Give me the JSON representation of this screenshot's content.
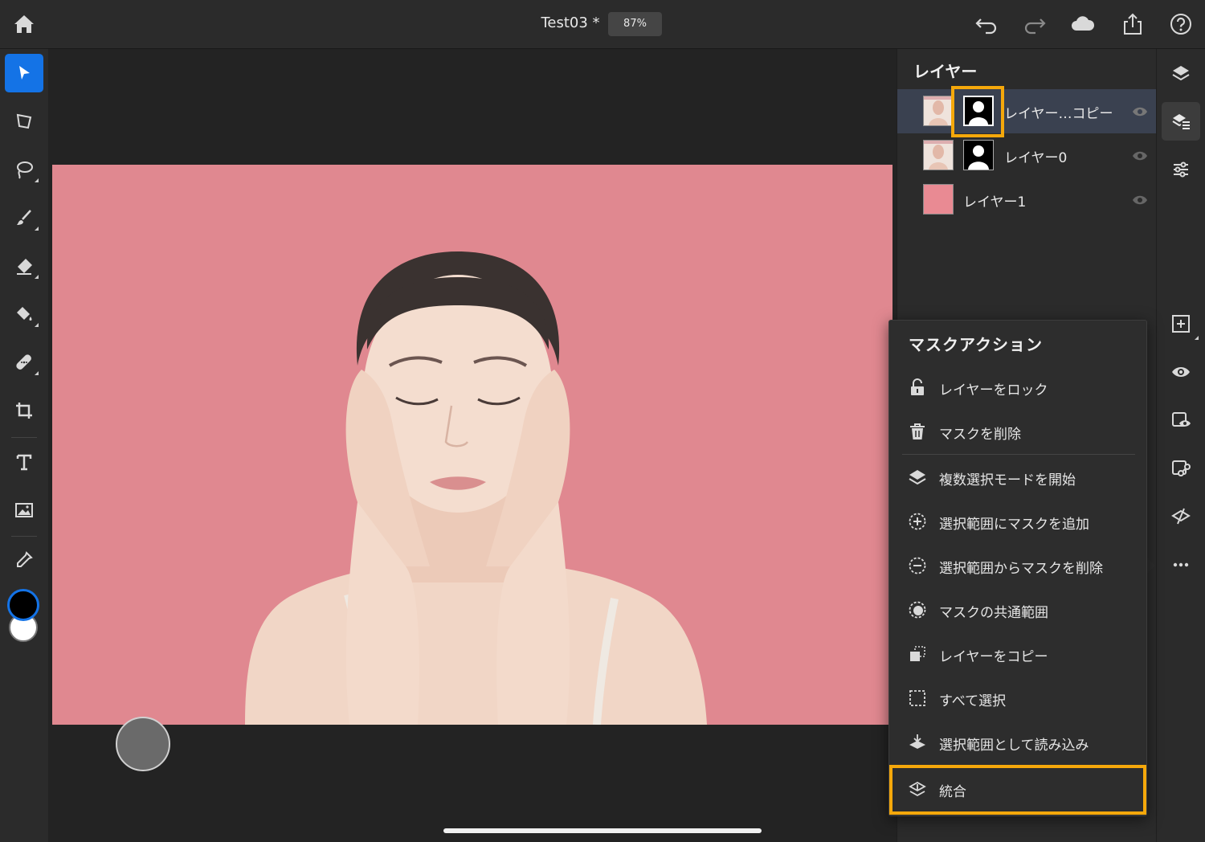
{
  "app": {
    "doc_title": "Test03 *",
    "zoom": "87%"
  },
  "layers_panel": {
    "title": "レイヤー",
    "layers": [
      {
        "name": "レイヤー…コピー",
        "selected": true,
        "has_mask": true
      },
      {
        "name": "レイヤー0",
        "selected": false,
        "has_mask": true
      },
      {
        "name": "レイヤー1",
        "selected": false,
        "has_mask": false
      }
    ]
  },
  "mask_menu": {
    "title": "マスクアクション",
    "items": [
      {
        "label": "レイヤーをロック",
        "icon": "unlock-icon"
      },
      {
        "label": "マスクを削除",
        "icon": "trash-icon"
      },
      {
        "label": "複数選択モードを開始",
        "icon": "layers-stack-icon"
      },
      {
        "label": "選択範囲にマスクを追加",
        "icon": "selection-add-icon"
      },
      {
        "label": "選択範囲からマスクを削除",
        "icon": "selection-subtract-icon"
      },
      {
        "label": "マスクの共通範囲",
        "icon": "selection-intersect-icon"
      },
      {
        "label": "レイヤーをコピー",
        "icon": "copy-layer-icon"
      },
      {
        "label": "すべて選択",
        "icon": "select-all-icon"
      },
      {
        "label": "選択範囲として読み込み",
        "icon": "load-selection-icon"
      },
      {
        "label": "統合",
        "icon": "merge-icon",
        "highlighted": true
      }
    ]
  },
  "colors": {
    "canvas_bg": "#e08890",
    "accent": "#1473e6",
    "highlight": "#f5a80b",
    "foreground_color": "#000000",
    "background_color": "#ffffff"
  }
}
